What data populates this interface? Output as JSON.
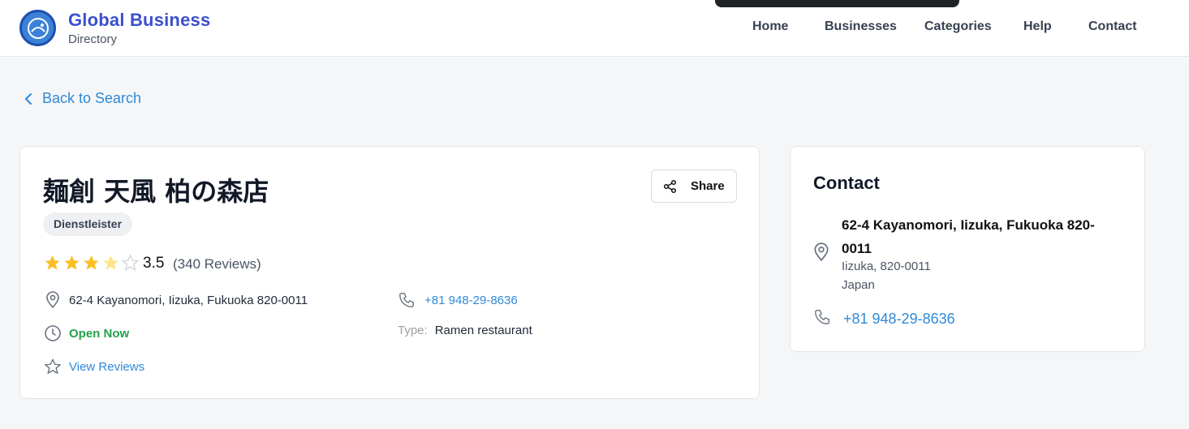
{
  "header": {
    "brand_title": "Global Business",
    "brand_subtitle": "Directory",
    "nav": [
      {
        "label": "Home"
      },
      {
        "label": "Businesses"
      },
      {
        "label": "Categories"
      },
      {
        "label": "Help"
      },
      {
        "label": "Contact"
      }
    ]
  },
  "back_link": {
    "label": "Back to Search",
    "icon": "chevron-left-icon"
  },
  "business": {
    "name": "麺創 天風 柏の森店",
    "share_label": "Share",
    "category_tag": "Dienstleister",
    "rating": {
      "value": 3.5,
      "display": "3.5",
      "reviews_text": "(340 Reviews)",
      "max_stars": 5
    },
    "address": "62-4 Kayanomori, Iizuka, Fukuoka 820-0011",
    "phone": "+81 948-29-8636",
    "status": "Open Now",
    "type_label": "Type:",
    "type_value": "Ramen restaurant",
    "view_reviews": "View Reviews"
  },
  "contact": {
    "title": "Contact",
    "address_line1": "62-4 Kayanomori, Iizuka, Fukuoka 820-0011",
    "address_line2": "Iizuka, 820-0011",
    "address_line3": "Japan",
    "phone": "+81 948-29-8636"
  },
  "colors": {
    "brand": "#3b4fd0",
    "link": "#2f89d8",
    "open_status": "#22a04b",
    "star_filled": "#fbbf24",
    "star_empty": "#d1d5db"
  }
}
